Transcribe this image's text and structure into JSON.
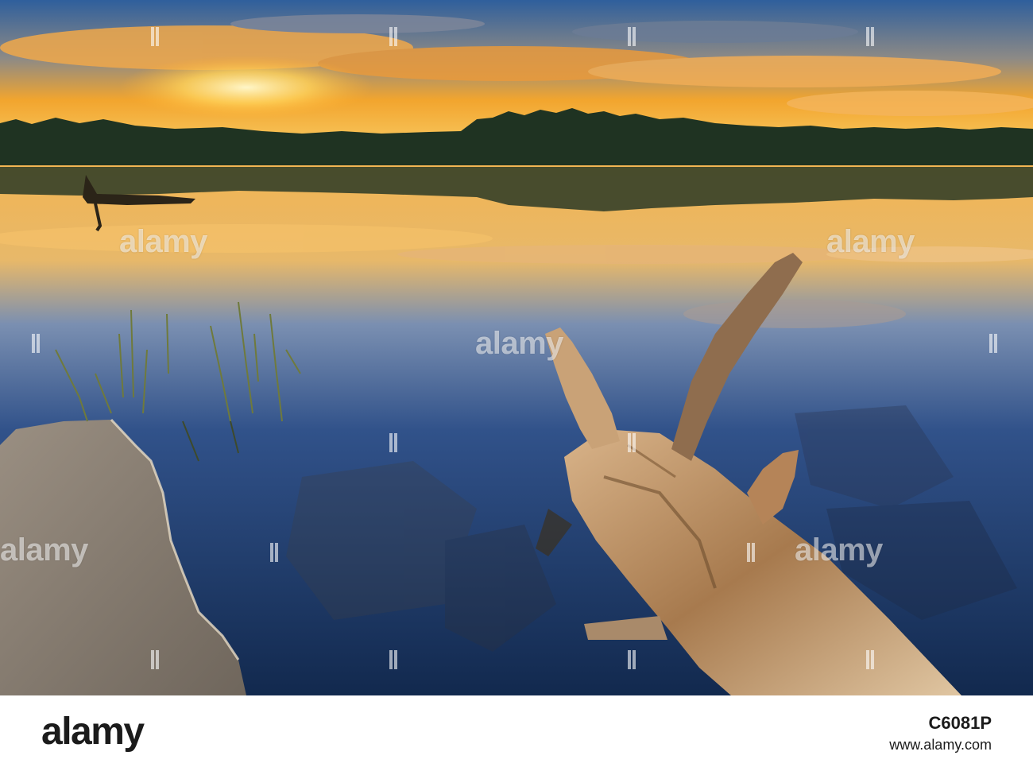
{
  "photo": {
    "subject": "lake-at-sunset-with-driftwood",
    "colors": {
      "sky_gold": "#f6a623",
      "sky_blue": "#3f6fa8",
      "water_deep": "#1d3a66",
      "trees": "#1f3322",
      "driftwood": "#b98a5a",
      "rock": "#8f857a"
    }
  },
  "watermark": {
    "text": "alamy",
    "repeat_label": "alamy"
  },
  "footer": {
    "brand": "alamy",
    "image_id": "C6081P",
    "url": "www.alamy.com"
  }
}
